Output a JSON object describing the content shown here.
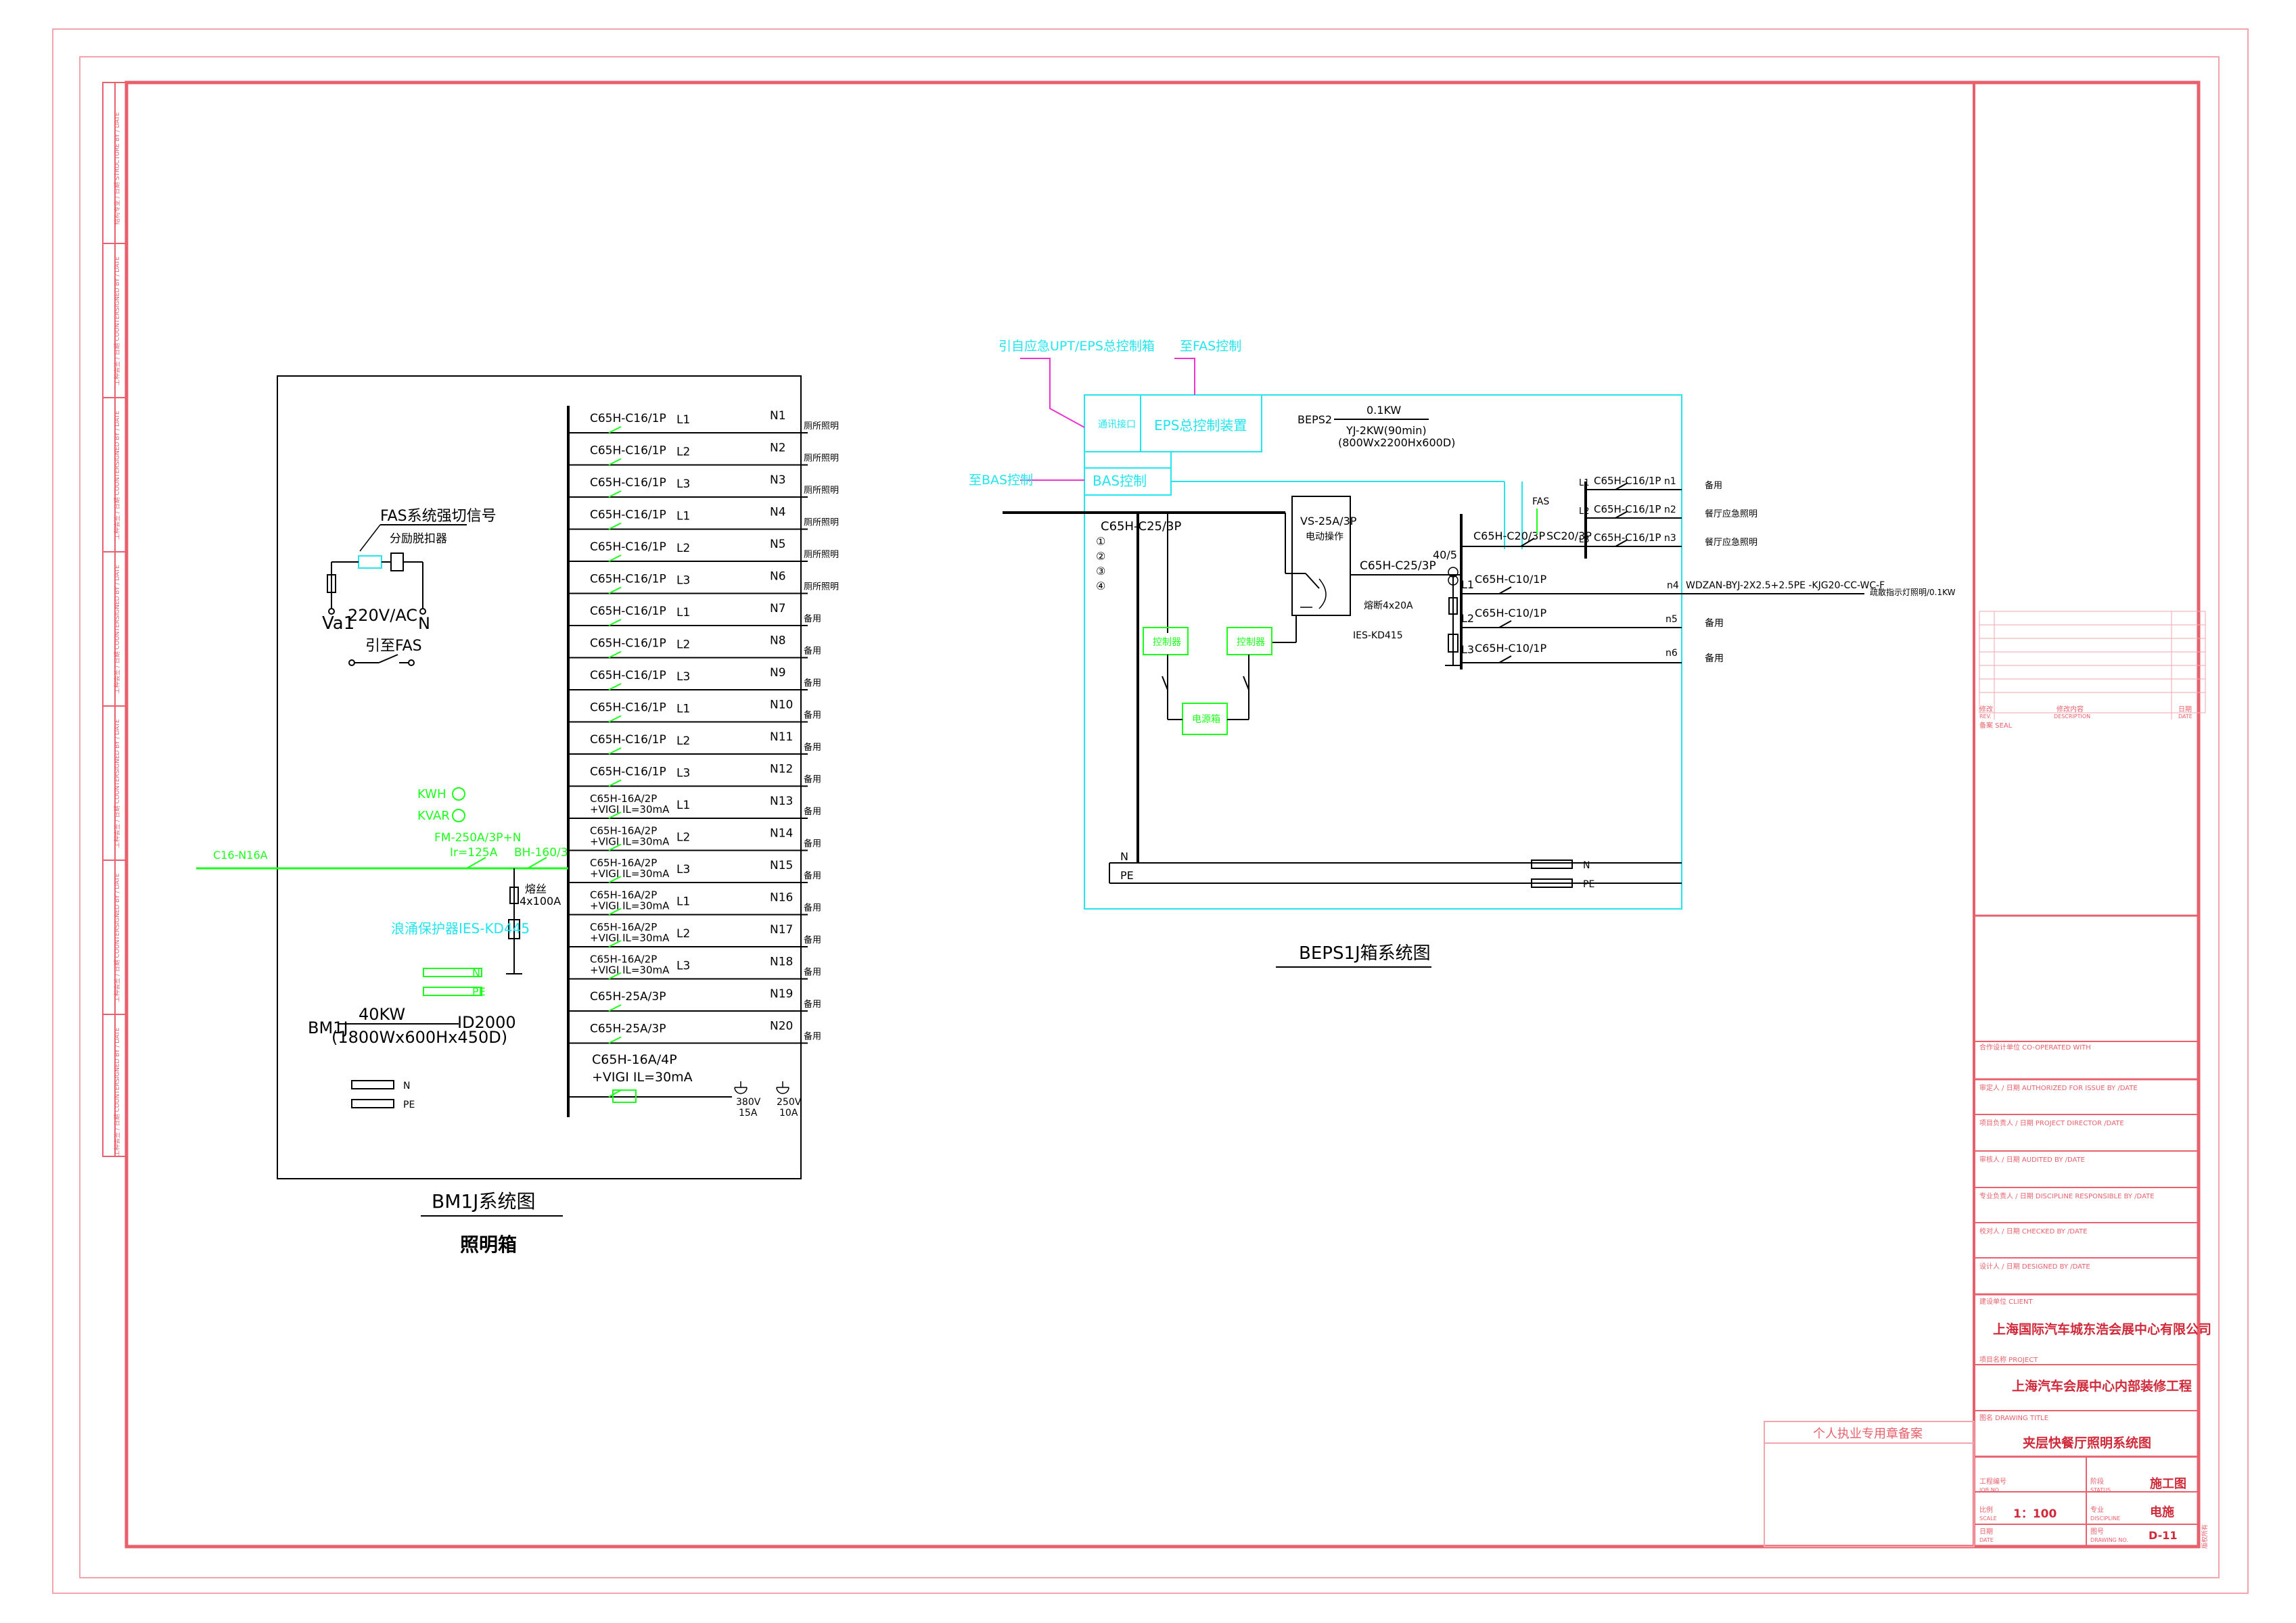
{
  "bm1j": {
    "fas_signal": "FAS系统强切信号",
    "shunt_release": "分励脱扣器",
    "va1": "Va1",
    "vac": "220V/AC",
    "n": "N",
    "fas_lead": "引至FAS",
    "kwh": "KWH",
    "varh": "KVAR",
    "incoming": "C16-N16A",
    "main_breaker": "FM-250A/3P+N",
    "main_ir": "Ir=125A",
    "isolator": "BH-160/3",
    "fuse": "熔丝",
    "fuse_rating": "4x100A",
    "spd": "浪涌保护器IES-KD445",
    "bar_n": "N",
    "bar_pe": "PE",
    "bar_n2": "N",
    "bar_pe2": "PE",
    "panel_id": "BM1J",
    "power": "40KW",
    "size": "(1800Wx600Hx450D)",
    "id2000": "ID2000",
    "rows": [
      {
        "brk": "C65H-C16/1P",
        "ph": "L1",
        "nn": "N1",
        "use": "厕所照明"
      },
      {
        "brk": "C65H-C16/1P",
        "ph": "L2",
        "nn": "N2",
        "use": "厕所照明"
      },
      {
        "brk": "C65H-C16/1P",
        "ph": "L3",
        "nn": "N3",
        "use": "厕所照明"
      },
      {
        "brk": "C65H-C16/1P",
        "ph": "L1",
        "nn": "N4",
        "use": "厕所照明"
      },
      {
        "brk": "C65H-C16/1P",
        "ph": "L2",
        "nn": "N5",
        "use": "厕所照明"
      },
      {
        "brk": "C65H-C16/1P",
        "ph": "L3",
        "nn": "N6",
        "use": "厕所照明"
      },
      {
        "brk": "C65H-C16/1P",
        "ph": "L1",
        "nn": "N7",
        "use": "备用"
      },
      {
        "brk": "C65H-C16/1P",
        "ph": "L2",
        "nn": "N8",
        "use": "备用"
      },
      {
        "brk": "C65H-C16/1P",
        "ph": "L3",
        "nn": "N9",
        "use": "备用"
      },
      {
        "brk": "C65H-C16/1P",
        "ph": "L1",
        "nn": "N10",
        "use": "备用"
      },
      {
        "brk": "C65H-C16/1P",
        "ph": "L2",
        "nn": "N11",
        "use": "备用"
      },
      {
        "brk": "C65H-C16/1P",
        "ph": "L3",
        "nn": "N12",
        "use": "备用"
      },
      {
        "brk": "C65H-16A/2P",
        "brk2": "+VIGI IL=30mA",
        "ph": "L1",
        "nn": "N13",
        "use": "备用"
      },
      {
        "brk": "C65H-16A/2P",
        "brk2": "+VIGI IL=30mA",
        "ph": "L2",
        "nn": "N14",
        "use": "备用"
      },
      {
        "brk": "C65H-16A/2P",
        "brk2": "+VIGI IL=30mA",
        "ph": "L3",
        "nn": "N15",
        "use": "备用"
      },
      {
        "brk": "C65H-16A/2P",
        "brk2": "+VIGI IL=30mA",
        "ph": "L1",
        "nn": "N16",
        "use": "备用"
      },
      {
        "brk": "C65H-16A/2P",
        "brk2": "+VIGI IL=30mA",
        "ph": "L2",
        "nn": "N17",
        "use": "备用"
      },
      {
        "brk": "C65H-16A/2P",
        "brk2": "+VIGI IL=30mA",
        "ph": "L3",
        "nn": "N18",
        "use": "备用"
      },
      {
        "brk": "C65H-25A/3P",
        "ph": "",
        "nn": "N19",
        "use": "备用"
      },
      {
        "brk": "C65H-25A/3P",
        "ph": "",
        "nn": "N20",
        "use": "备用"
      }
    ],
    "last_brk": "C65H-16A/4P",
    "last_brk2": "+VIGI IL=30mA",
    "sock1_v": "380V",
    "sock1_a": "15A",
    "sock2_v": "250V",
    "sock2_a": "10A",
    "title": "BM1J系统图",
    "subtitle": "照明箱"
  },
  "beps": {
    "label_upt": "引自应急UPT/EPS总控制箱",
    "label_fas": "至FAS控制",
    "label_bas": "至BAS控制",
    "box_iface": "通讯接口",
    "box_eps": "EPS总控制装置",
    "box_bas": "BAS控制",
    "beps2": "BEPS2",
    "kw": "0.1KW",
    "yj": "YJ-2KW(90min)",
    "dim": "(800Wx2200Hx600D)",
    "main_brk": "C65H-C25/3P",
    "circ": [
      "①",
      "②",
      "③",
      "④"
    ],
    "vs": "VS-25A/3P",
    "vs2": "电动操作",
    "c65_25": "C65H-C25/3P",
    "ct": "40/5",
    "fuse": "熔断4x20A",
    "spd": "IES-KD415",
    "ctrl1": "控制器",
    "ctrl2": "控制器",
    "power": "电源箱",
    "c20": "C65H-C20/3P",
    "fas": "FAS",
    "sc20": "SC20/3P",
    "outs": [
      {
        "ph": "L1",
        "brk": "C65H-C16/1P",
        "nn": "n1",
        "use": "备用"
      },
      {
        "ph": "L2",
        "brk": "C65H-C16/1P",
        "nn": "n2",
        "use": "餐厅应急照明"
      },
      {
        "ph": "L3",
        "brk": "C65H-C16/1P",
        "nn": "n3",
        "use": "餐厅应急照明"
      }
    ],
    "l1": "L1",
    "l1_brk": "C65H-C10/1P",
    "n4": "n4",
    "cable": "WDZAN-BYJ-2X2.5+2.5PE -KJG20-CC-WC-F",
    "n4_use": "疏散指示灯照明/0.1KW",
    "l2": "L2",
    "l2_brk": "C65H-C10/1P",
    "n5": "n5",
    "n5_use": "备用",
    "l3": "L3",
    "l3_brk": "C65H-C10/1P",
    "n6": "n6",
    "n6_use": "备用",
    "bus_n": "N",
    "bus_pe": "PE",
    "bar_n": "N",
    "bar_pe": "PE",
    "title": "BEPS1J箱系统图"
  },
  "titleblock": {
    "rev_header": [
      "修改",
      "修改内容",
      "日期"
    ],
    "rev_header2": [
      "REV.",
      "DESCRIPTION",
      "DATE"
    ],
    "seal": "备案 SEAL",
    "coop": "合作设计单位  CO-OPERATED WITH",
    "rows": [
      "审定人 / 日期   AUTHORIZED FOR ISSUE BY  /DATE",
      "项目负责人 / 日期   PROJECT DIRECTOR  /DATE",
      "审核人 / 日期   AUDITED BY  /DATE",
      "专业负责人 / 日期   DISCIPLINE RESPONSIBLE BY  /DATE",
      "校对人 / 日期   CHECKED BY  /DATE",
      "设计人 / 日期   DESIGNED BY  /DATE"
    ],
    "client_label": "建设单位  CLIENT",
    "client": "上海国际汽车城东浩会展中心有限公司",
    "project_label": "项目名称  PROJECT",
    "project": "上海汽车会展中心内部装修工程",
    "drawing_label": "图名  DRAWING TITLE",
    "drawing": "夹层快餐厅照明系统图",
    "stamp": "个人执业专用章备案",
    "jobno_label": "工程编号",
    "jobno_label2": "JOB NO.",
    "status_label": "阶段",
    "status_label2": "STATUS",
    "status": "施工图",
    "scale_label": "比例",
    "scale_label2": "SCALE",
    "scale": "1：100",
    "disc_label": "专业",
    "disc_label2": "DISCIPLINE",
    "disc": "电施",
    "date_label": "日期",
    "date_label2": "DATE",
    "dwgno_label": "图号",
    "dwgno_label2": "DRAWING NO.",
    "dwgno": "D-11",
    "side_note": "版权所有"
  },
  "margin_labels": [
    "结构专业 / 日期  STRUCTURE BY / DATE",
    "工种会签 / 日期  COUNTERSIGNED BY / DATE",
    "工种会签 / 日期  COUNTERSIGNED BY / DATE",
    "工种会签 / 日期  COUNTERSIGNED BY / DATE",
    "工种会签 / 日期  COUNTERSIGNED BY / DATE",
    "工种会签 / 日期  COUNTERSIGNED BY / DATE",
    "工种会签 / 日期  COUNTERSIGNED BY / DATE"
  ],
  "colors": {
    "frame": "#e8606c",
    "green": "#1aff1a",
    "cyan": "#22e5ee",
    "magenta": "#ee33cc"
  }
}
